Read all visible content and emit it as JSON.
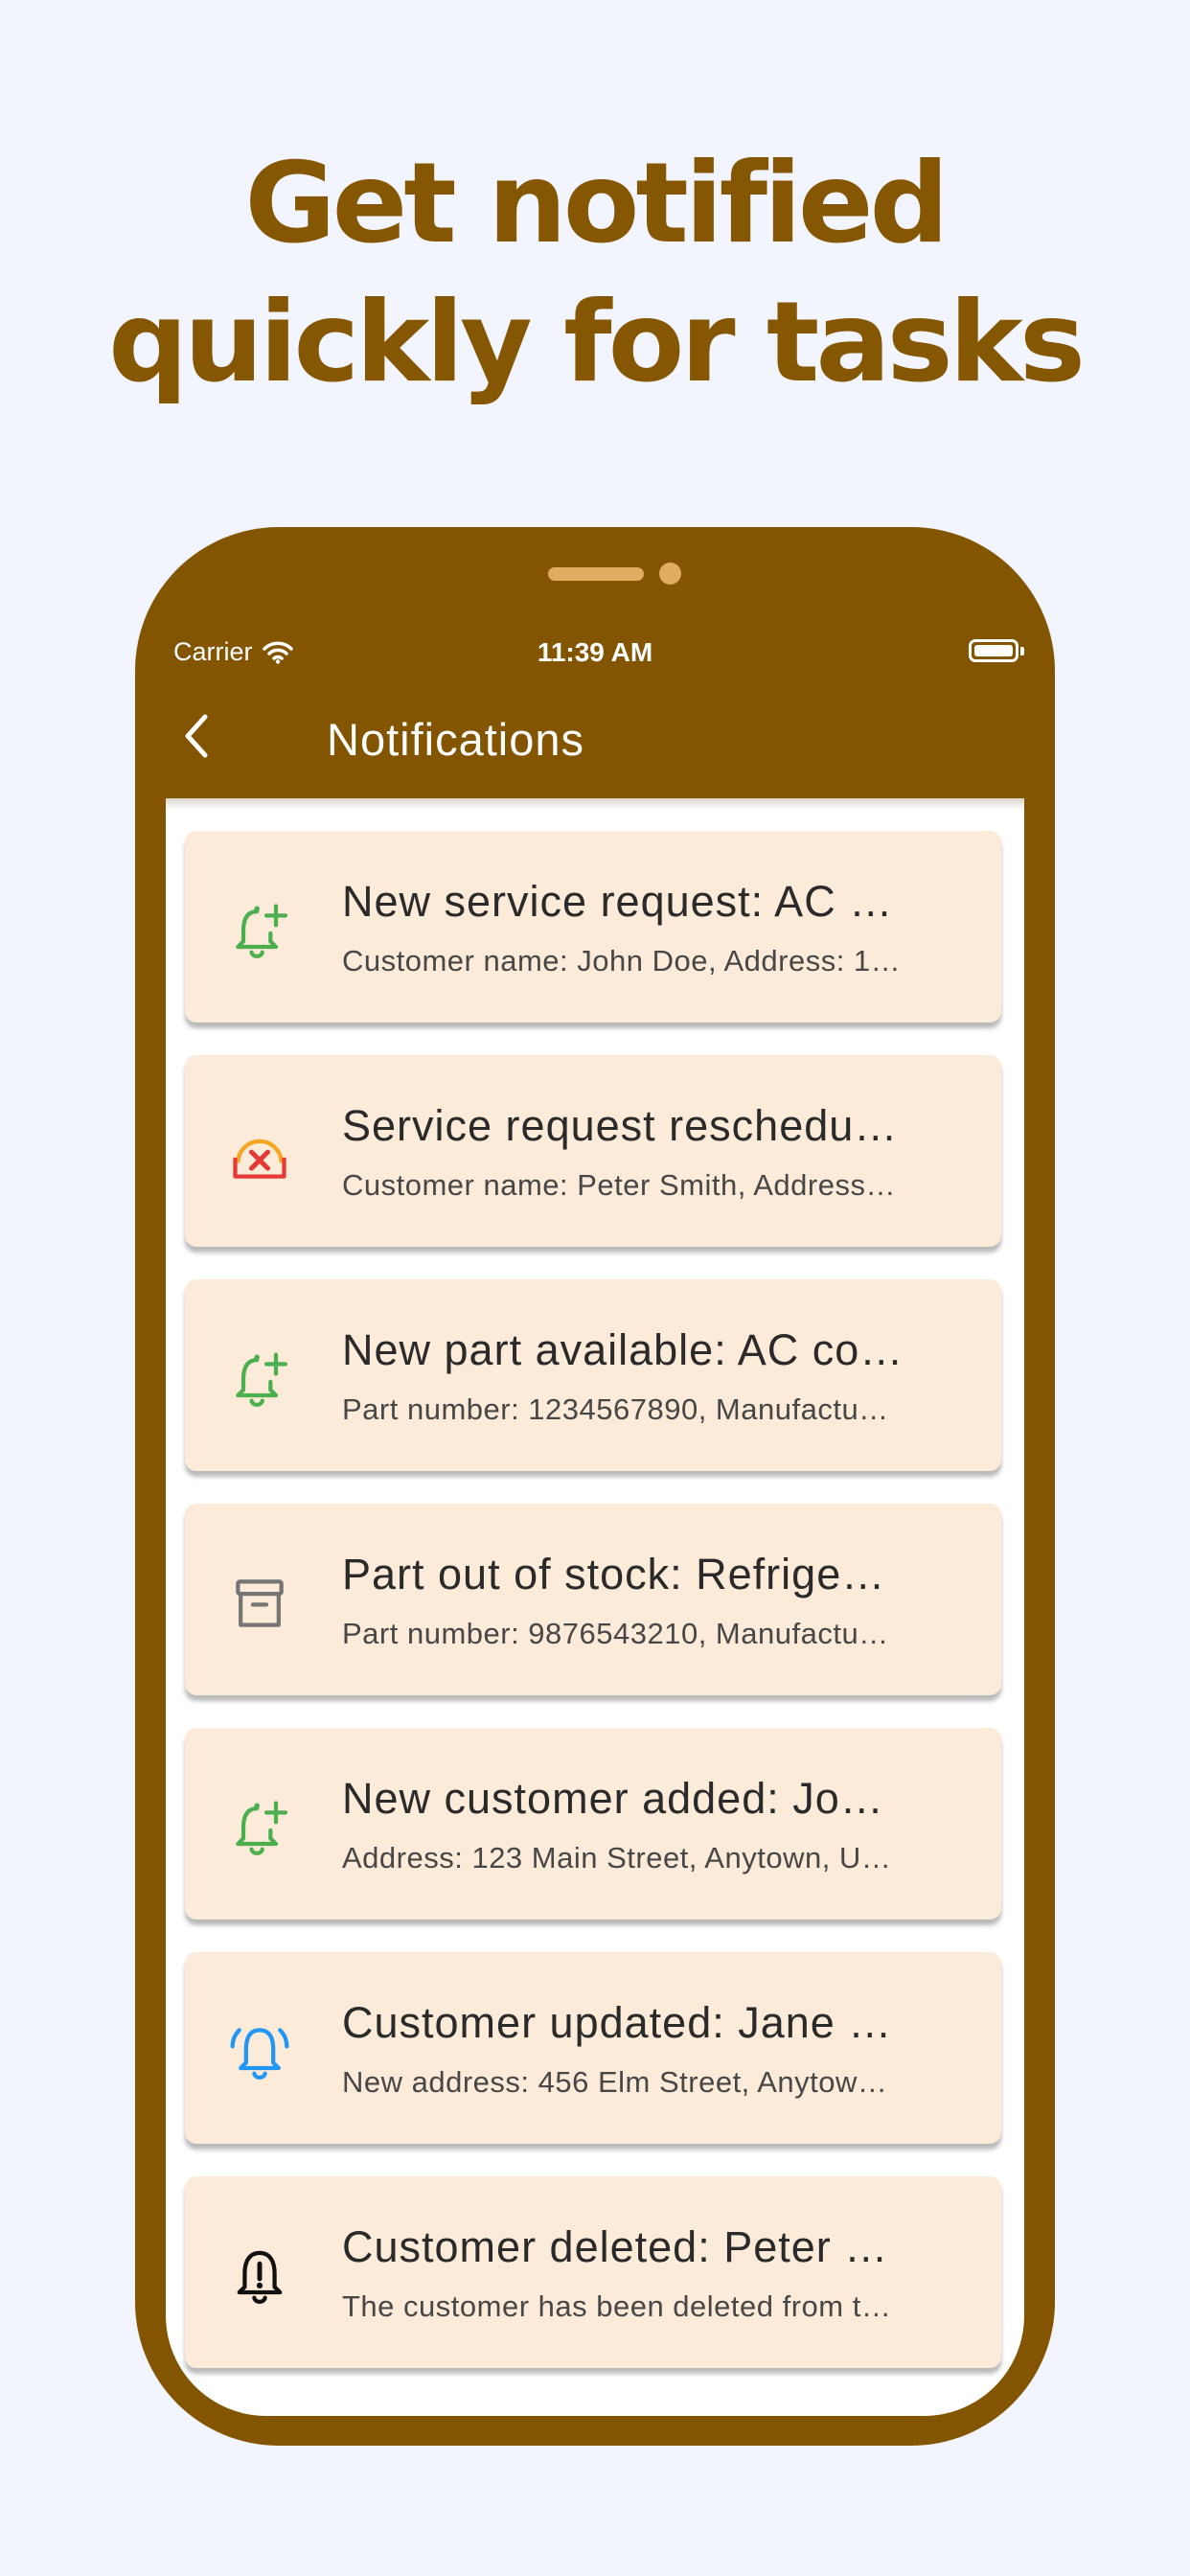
{
  "headline": {
    "line1": "Get notified",
    "line2": "quickly for tasks"
  },
  "colors": {
    "brand": "#835501",
    "card_background": "#fbebd8",
    "page_background": "#f2f5fd"
  },
  "status_bar": {
    "carrier": "Carrier",
    "time": "11:39 AM"
  },
  "app_bar": {
    "title": "Notifications",
    "back_icon": "chevron-left-icon"
  },
  "notifications": [
    {
      "icon": "bell-plus-icon",
      "title": "New service request: AC …",
      "subtitle": "Customer name: John Doe, Address: 1…"
    },
    {
      "icon": "alarm-cancel-icon",
      "title": "Service request reschedu…",
      "subtitle": "Customer name: Peter Smith, Address…"
    },
    {
      "icon": "bell-plus-icon",
      "title": "New part available: AC co…",
      "subtitle": "Part number: 1234567890, Manufactu…"
    },
    {
      "icon": "archive-box-icon",
      "title": "Part out of stock: Refrige…",
      "subtitle": "Part number: 9876543210, Manufactu…"
    },
    {
      "icon": "bell-plus-icon",
      "title": "New customer added: Jo…",
      "subtitle": "Address: 123 Main Street, Anytown, U…"
    },
    {
      "icon": "bell-ringing-icon",
      "title": "Customer updated: Jane …",
      "subtitle": "New address: 456 Elm Street, Anytow…"
    },
    {
      "icon": "bell-alert-icon",
      "title": "Customer deleted: Peter …",
      "subtitle": "The customer has been deleted from t…"
    }
  ]
}
